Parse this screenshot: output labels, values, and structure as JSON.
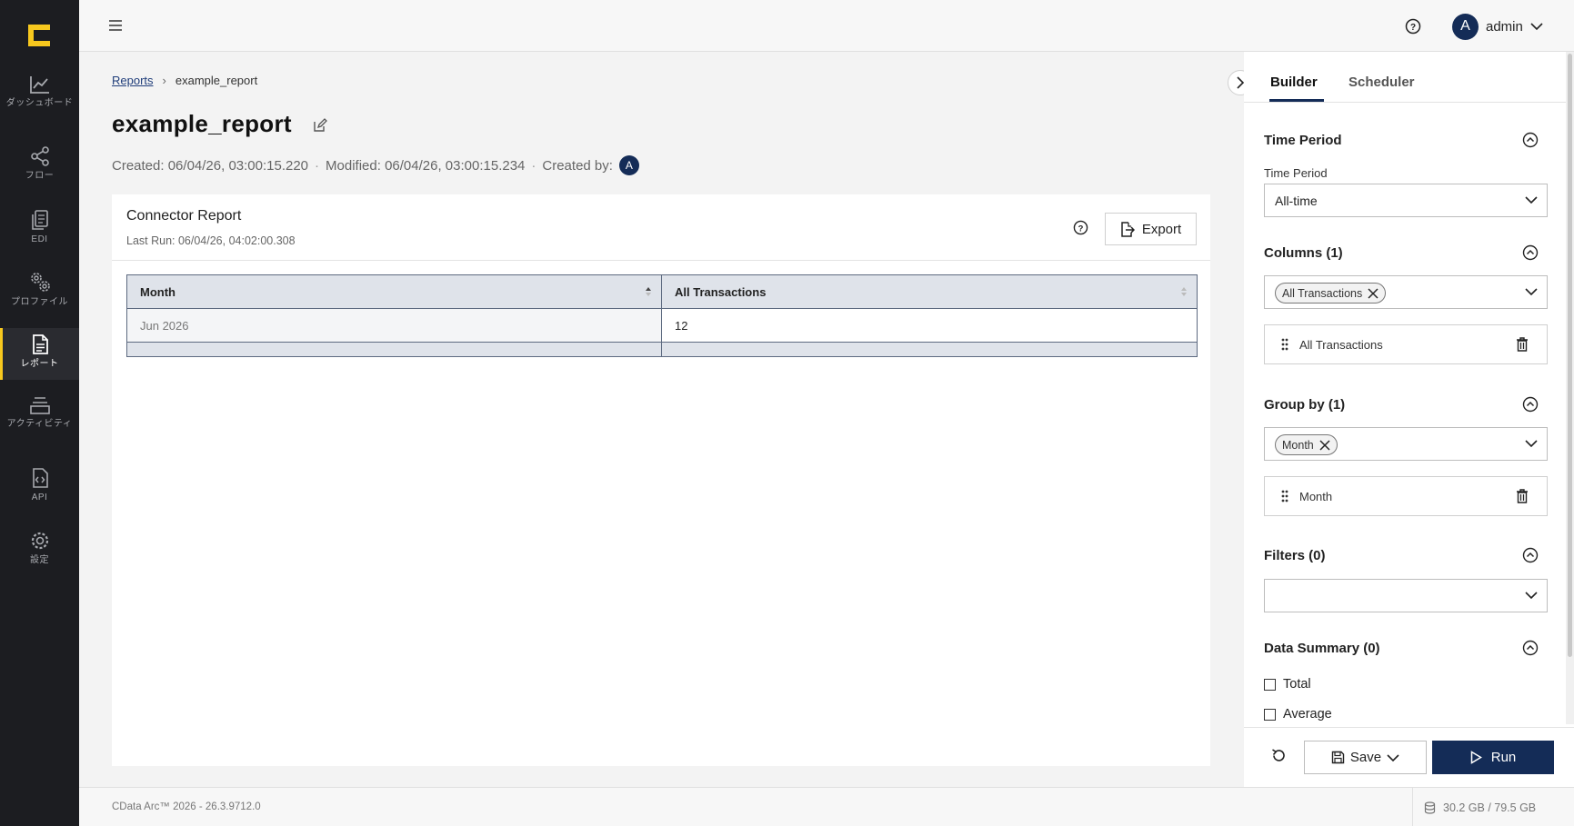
{
  "sidebar": {
    "items": [
      {
        "label": "ダッシュボード",
        "icon": "chart-line-icon"
      },
      {
        "label": "フロー",
        "icon": "share-nodes-icon"
      },
      {
        "label": "EDI",
        "icon": "files-icon"
      },
      {
        "label": "プロファイル",
        "icon": "gears-icon"
      },
      {
        "label": "レポート",
        "icon": "report-file-icon",
        "active": true
      },
      {
        "label": "アクティビティ",
        "icon": "layers-icon"
      },
      {
        "label": "API",
        "icon": "code-file-icon"
      },
      {
        "label": "設定",
        "icon": "settings-gear-icon"
      }
    ]
  },
  "topbar": {
    "user_initial": "A",
    "user_name": "admin"
  },
  "breadcrumb": {
    "parent": "Reports",
    "separator": "›",
    "current": "example_report"
  },
  "page": {
    "title": "example_report",
    "created_label": "Created:",
    "created_value": "06/04/26, 03:00:15.220",
    "modified_label": "Modified:",
    "modified_value": "06/04/26, 03:00:15.234",
    "created_by_label": "Created by:",
    "created_by_initial": "A",
    "dot": "·"
  },
  "report": {
    "title": "Connector Report",
    "last_run": "Last Run: 06/04/26, 04:02:00.308",
    "export_label": "Export",
    "columns": [
      "Month",
      "All Transactions"
    ],
    "rows": [
      [
        "Jun 2026",
        "12"
      ]
    ]
  },
  "panel": {
    "tabs": [
      "Builder",
      "Scheduler"
    ],
    "time_period": {
      "title": "Time Period",
      "field_label": "Time Period",
      "value": "All-time"
    },
    "columns": {
      "title": "Columns (1)",
      "chip": "All Transactions",
      "item": "All Transactions"
    },
    "group_by": {
      "title": "Group by (1)",
      "chip": "Month",
      "item": "Month"
    },
    "filters": {
      "title": "Filters (0)"
    },
    "data_summary": {
      "title": "Data Summary (0)",
      "options": [
        "Total",
        "Average"
      ]
    },
    "save_label": "Save",
    "run_label": "Run"
  },
  "footer": {
    "version": "CData Arc™ 2026 - 26.3.9712.0",
    "storage": "30.2 GB / 79.5 GB"
  },
  "colors": {
    "sidebar_bg": "#1c1d21",
    "accent_yellow": "#f7c81e",
    "primary_navy": "#142c57"
  }
}
